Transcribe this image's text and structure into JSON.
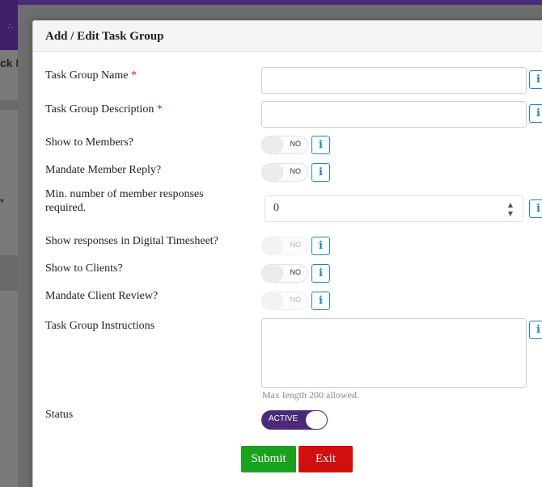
{
  "background": {
    "page_title_fragment": "ck L"
  },
  "modal": {
    "title": "Add / Edit Task Group"
  },
  "form": {
    "task_group_name": {
      "label": "Task Group Name",
      "required_mark": "*",
      "value": ""
    },
    "task_group_description": {
      "label": "Task Group Description",
      "required_mark": "*",
      "value": ""
    },
    "show_to_members": {
      "label": "Show to Members?",
      "state": "NO"
    },
    "mandate_member_reply": {
      "label": "Mandate Member Reply?",
      "state": "NO"
    },
    "min_member_responses": {
      "label": "Min. number of member responses required.",
      "value": "0"
    },
    "show_in_digital_timesheet": {
      "label": "Show responses in Digital Timesheet?",
      "state": "NO",
      "disabled": true
    },
    "show_to_clients": {
      "label": "Show to Clients?",
      "state": "NO"
    },
    "mandate_client_review": {
      "label": "Mandate Client Review?",
      "state": "NO",
      "disabled": true
    },
    "task_group_instructions": {
      "label": "Task Group Instructions",
      "value": "",
      "hint": "Max length 200 allowed."
    },
    "status": {
      "label": "Status",
      "state": "ACTIVE"
    }
  },
  "actions": {
    "submit_label": "Submit",
    "exit_label": "Exit"
  },
  "info_icon_glyph": "i",
  "colors": {
    "brand": "#4b2a7a",
    "info": "#1a86c9",
    "submit": "#18a21d",
    "exit": "#d10f0f",
    "required": "#d21c1c"
  }
}
